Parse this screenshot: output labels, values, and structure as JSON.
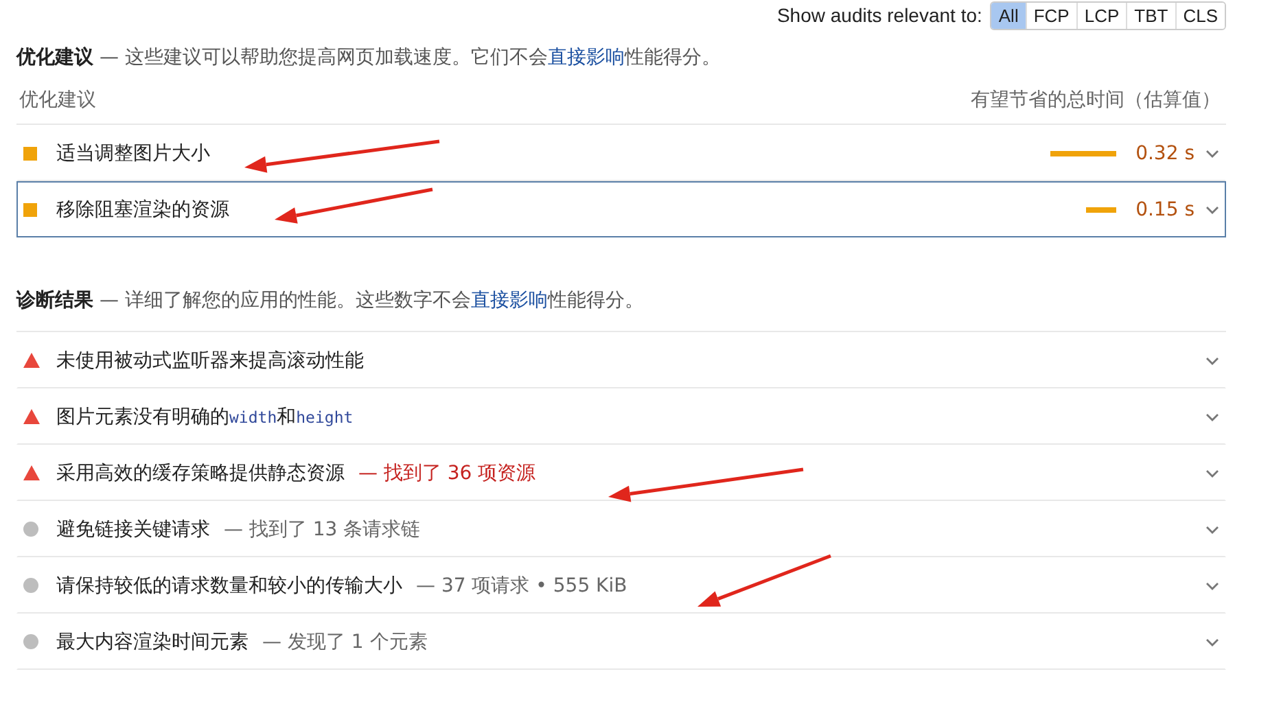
{
  "filter": {
    "label": "Show audits relevant to:",
    "options": [
      {
        "label": "All",
        "selected": true
      },
      {
        "label": "FCP",
        "selected": false
      },
      {
        "label": "LCP",
        "selected": false
      },
      {
        "label": "TBT",
        "selected": false
      },
      {
        "label": "CLS",
        "selected": false
      }
    ]
  },
  "opportunities": {
    "title": "优化建议",
    "description": "— 这些建议可以帮助您提高网页加载速度。它们不会",
    "link": "直接影响",
    "description_end": "性能得分。",
    "column_1": "优化建议",
    "column_2": "有望节省的总时间（估算值）",
    "items": [
      {
        "title": "适当调整图片大小",
        "value": "0.32 s",
        "selected": false
      },
      {
        "title": "移除阻塞渲染的资源",
        "value": "0.15 s",
        "selected": true
      }
    ]
  },
  "diagnostics": {
    "title": "诊断结果",
    "description": "— 详细了解您的应用的性能。这些数字不会",
    "link": "直接影响",
    "description_end": "性能得分。",
    "items": [
      {
        "kind": "fail",
        "title_parts": [
          {
            "kind": "text",
            "text": "未使用被动式监听器来提高滚动性能"
          }
        ]
      },
      {
        "kind": "fail",
        "title_parts": [
          {
            "kind": "text",
            "text": "图片元素没有明确的"
          },
          {
            "kind": "code",
            "text": "width"
          },
          {
            "kind": "text",
            "text": "和"
          },
          {
            "kind": "code",
            "text": "height"
          }
        ]
      },
      {
        "kind": "fail",
        "title_parts": [
          {
            "kind": "text",
            "text": "采用高效的缓存策略提供静态资源"
          }
        ],
        "detail": "— 找到了 36 项资源"
      },
      {
        "kind": "info",
        "title_parts": [
          {
            "kind": "text",
            "text": "避免链接关键请求"
          }
        ],
        "detail": "— 找到了 13 条请求链"
      },
      {
        "kind": "info",
        "title_parts": [
          {
            "kind": "text",
            "text": "请保持较低的请求数量和较小的传输大小"
          }
        ],
        "detail": "— 37 项请求 • 555 KiB"
      },
      {
        "kind": "info",
        "title_parts": [
          {
            "kind": "text",
            "text": "最大内容渲染时间元素"
          }
        ],
        "detail": "— 发现了 1 个元素"
      }
    ]
  }
}
